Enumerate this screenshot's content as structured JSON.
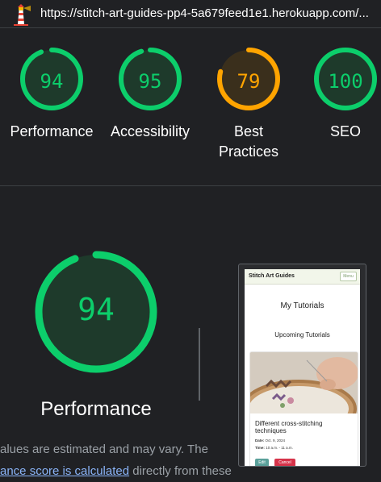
{
  "header": {
    "url": "https://stitch-art-guides-pp4-5a679feed1e1.herokuapp.com/...",
    "logo_icon": "lighthouse-icon"
  },
  "colors": {
    "pass": "#0cce6b",
    "average": "#ffa400",
    "pass_bg": "#1e3a2b",
    "average_bg": "#3a2f1c"
  },
  "categories": [
    {
      "score": "94",
      "score_value": 94,
      "label": "Performance",
      "status": "pass"
    },
    {
      "score": "95",
      "score_value": 95,
      "label": "Accessibility",
      "status": "pass"
    },
    {
      "score": "79",
      "score_value": 79,
      "label": "Best Practices",
      "status": "average"
    },
    {
      "score": "100",
      "score_value": 100,
      "label": "SEO",
      "status": "pass"
    }
  ],
  "performance": {
    "score": "94",
    "score_value": 94,
    "title": "Performance",
    "note_text": "alues are estimated and may vary. The",
    "note_link": "ance score is calculated",
    "note_after": " directly from these"
  },
  "screenshot": {
    "brand": "Stitch Art Guides",
    "menu_label": "Menu",
    "heading": "My Tutorials",
    "subheading": "Upcoming Tutorials",
    "card_title": "Different cross-stitching techniques",
    "date_label": "Date:",
    "date_value": "Oct. 9, 2024",
    "time_label": "Time:",
    "time_value": "10 a.m. - 11 a.m.",
    "edit_label": "Edit",
    "cancel_label": "Cancel"
  }
}
